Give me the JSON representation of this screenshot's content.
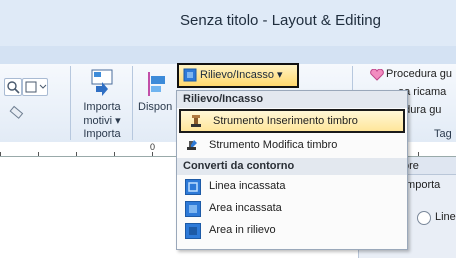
{
  "window": {
    "title": "Senza titolo - Layout & Editing"
  },
  "ribbon": {
    "import_group": {
      "button_label_line1": "Importa",
      "button_label_line2": "motivi ▾",
      "group_label": "Importa"
    },
    "dispose_label": "Dispon",
    "relief_button_label": "Rilievo/Incasso ▾",
    "right": {
      "procedure_1": "Procedura gu",
      "procedure_2": "oa ricama",
      "procedure_3": "edura gu",
      "group_label": "Tag"
    }
  },
  "ruler": {
    "mark": "0"
  },
  "dropdown": {
    "header_1": "Rilievo/Incasso",
    "items_1": [
      {
        "label": "Strumento Inserimento timbro",
        "icon": "stamp-insert-icon"
      },
      {
        "label": "Strumento Modifica timbro",
        "icon": "stamp-edit-icon"
      }
    ],
    "header_2": "Converti da contorno",
    "items_2": [
      {
        "label": "Linea incassata",
        "icon": "line-inset-icon"
      },
      {
        "label": "Area incassata",
        "icon": "area-inset-icon"
      },
      {
        "label": "Area in rilievo",
        "icon": "area-relief-icon"
      }
    ]
  },
  "right_panel": {
    "tab_label": "ore",
    "import_label": "Importa",
    "line_radio_label": "Linea"
  },
  "colors": {
    "accent_blue": "#2e7ad8",
    "highlight_border": "#1a1a1a",
    "highlight_fill": "#ffe69a"
  }
}
